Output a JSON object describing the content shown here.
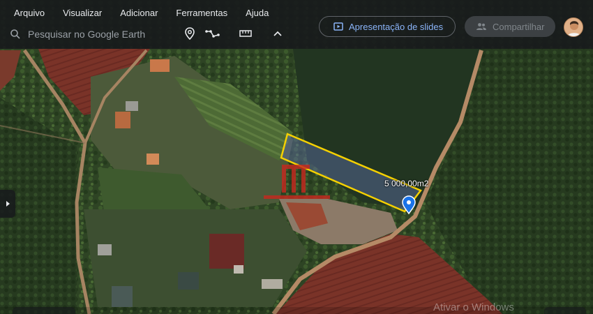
{
  "menu": {
    "items": [
      "Arquivo",
      "Visualizar",
      "Adicionar",
      "Ferramentas",
      "Ajuda"
    ]
  },
  "search": {
    "placeholder": "Pesquisar no Google Earth",
    "icon": "search-icon"
  },
  "toolbar": {
    "icons": [
      "location-pin-icon",
      "path-icon",
      "ruler-icon",
      "chevron-up-icon"
    ]
  },
  "actions": {
    "slides_label": "Apresentação de slides",
    "share_label": "Compartilhar"
  },
  "measurement": {
    "area_label": "5 000,00m2",
    "outline_color": "#f5d000"
  },
  "watermark": "Ativar o Windows",
  "colors": {
    "topbar": "#18191b",
    "accent": "#8ab4f8",
    "marker": "#1a73e8"
  }
}
